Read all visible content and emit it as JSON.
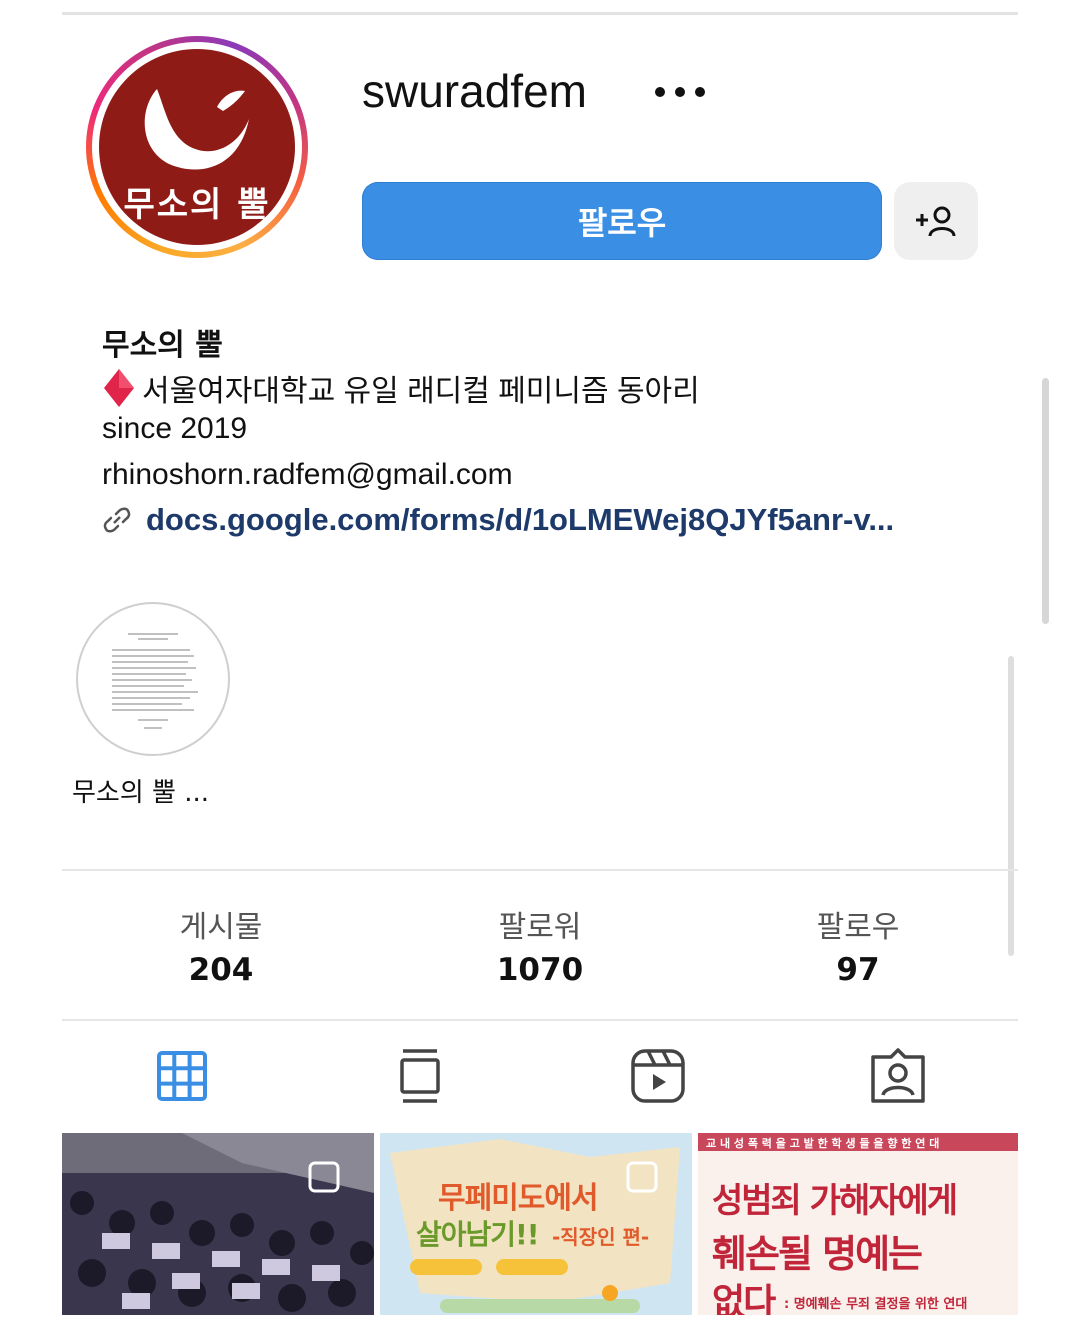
{
  "profile": {
    "username": "swuradfem",
    "avatar_text": "무소의 뿔",
    "follow_label": "팔로우"
  },
  "bio": {
    "name": "무소의 뿔",
    "description": "서울여자대학교 유일 래디컬 페미니즘 동아리",
    "since": "since 2019",
    "email": "rhinoshorn.radfem@gmail.com",
    "link": "docs.google.com/forms/d/1oLMEWej8QJYf5anr-v..."
  },
  "highlight": {
    "label": "무소의 뿔 ..."
  },
  "stats": [
    {
      "label": "게시물",
      "value": "204"
    },
    {
      "label": "팔로워",
      "value": "1070"
    },
    {
      "label": "팔로우",
      "value": "97"
    }
  ],
  "tabs": [
    "grid-icon",
    "feed-icon",
    "reels-icon",
    "tagged-icon"
  ],
  "posts": {
    "p2_title1": "무페미도에서",
    "p2_title2": "살아남기!!",
    "p2_subtitle": "-직장인 편-",
    "p3_header": "교 내  성 폭 력 을  고 발 한  학 생 들 을  향 한  연 대",
    "p3_line1": "성범죄 가해자에게",
    "p3_line2": "훼손될 명예는",
    "p3_line3": "없다",
    "p3_small": ": 명예훼손 무죄 결정을 위한 연대"
  },
  "colors": {
    "follow_button": "#3a8fe4",
    "avatar_bg": "#8f1b17",
    "link_text": "#1d3a6b",
    "active_tab": "#3a8fe4"
  }
}
